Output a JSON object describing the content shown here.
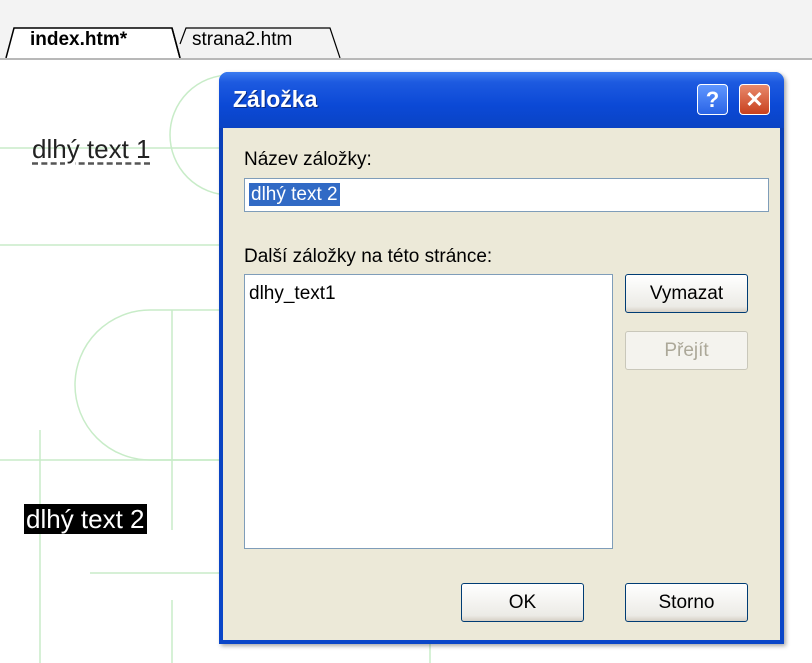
{
  "tabs": [
    {
      "label": "index.htm*",
      "active": true
    },
    {
      "label": "strana2.htm",
      "active": false
    }
  ],
  "canvas": {
    "anchor_1": "dlhý text 1",
    "anchor_2": "dlhý text 2"
  },
  "dialog": {
    "title": "Záložka",
    "help_glyph": "?",
    "close_glyph": "✕",
    "name_label": "Název záložky:",
    "name_value": "dlhý text 2",
    "other_label": "Další záložky na této stránce:",
    "bookmarks": [
      "dlhy_text1"
    ],
    "delete_label": "Vymazat",
    "goto_label": "Přejít",
    "ok_label": "OK",
    "cancel_label": "Storno"
  },
  "colors": {
    "titlebar": "#0a49d6",
    "selection": "#316ac5",
    "dialog_face": "#ece9d8",
    "guide_lines": "#c8ecc8"
  }
}
